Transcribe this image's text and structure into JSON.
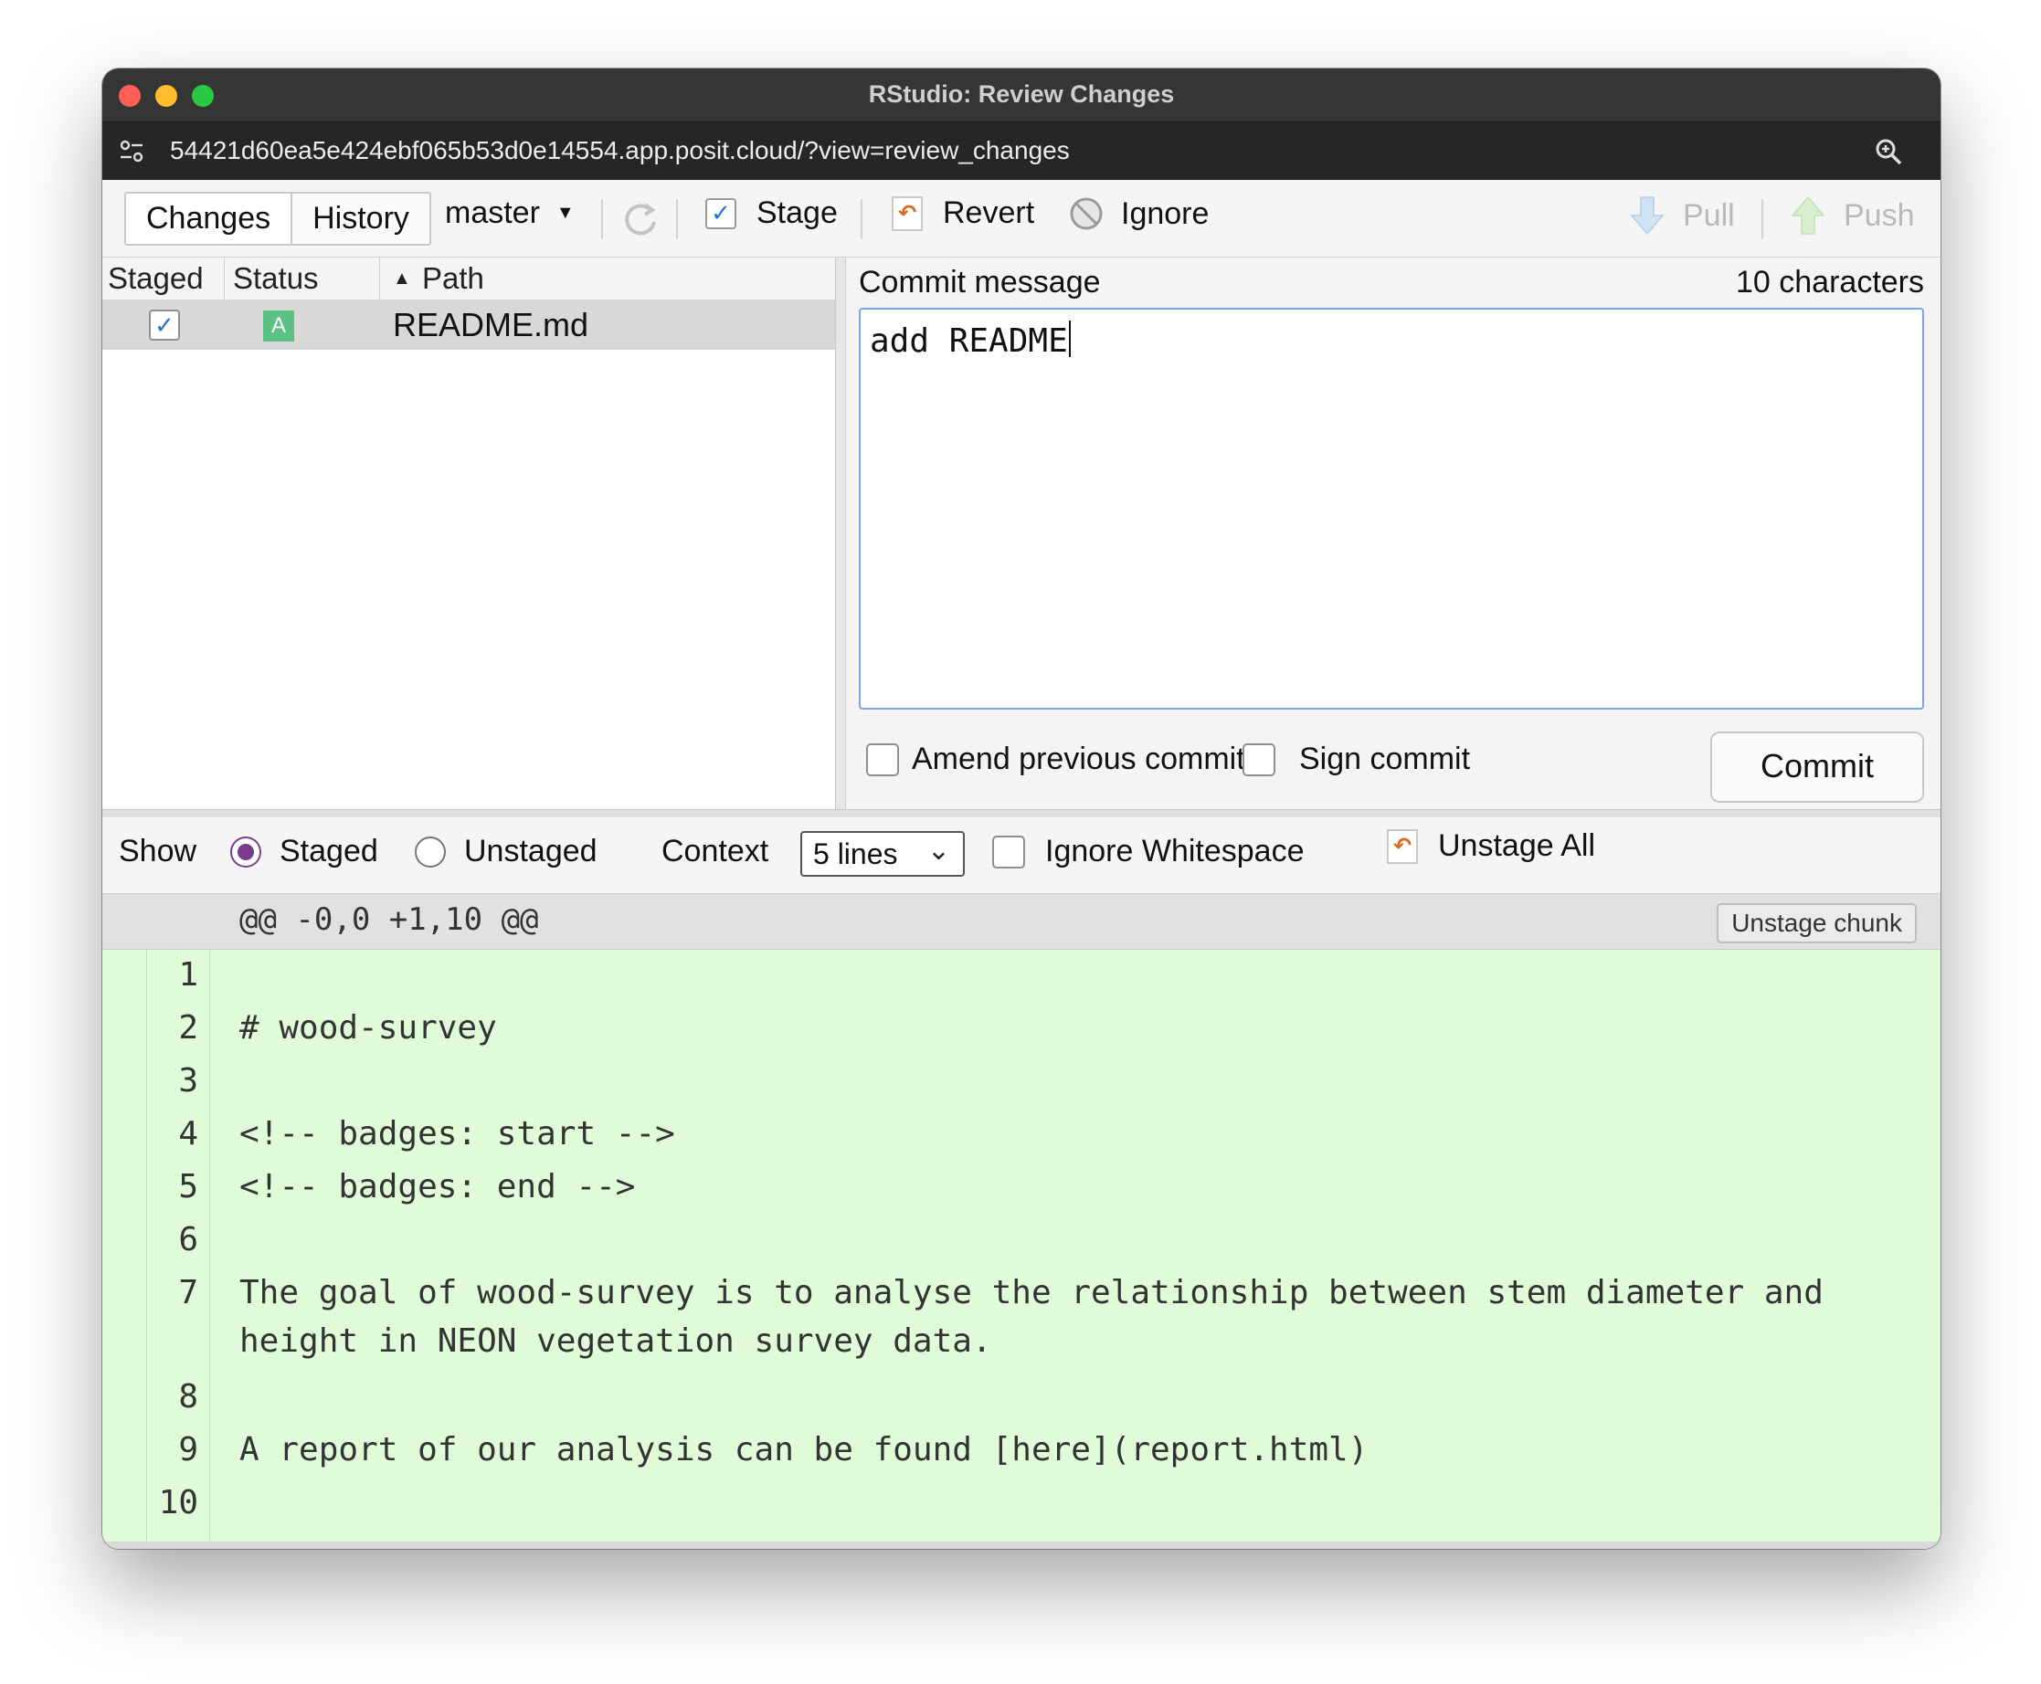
{
  "window": {
    "title": "RStudio: Review Changes",
    "url": "54421d60ea5e424ebf065b53d0e14554.app.posit.cloud/?view=review_changes"
  },
  "toolbar": {
    "tabs": [
      {
        "label": "Changes"
      },
      {
        "label": "History"
      }
    ],
    "branch": "master",
    "stage_label": "Stage",
    "revert_label": "Revert",
    "ignore_label": "Ignore",
    "pull_label": "Pull",
    "push_label": "Push"
  },
  "files": {
    "headers": {
      "staged": "Staged",
      "status": "Status",
      "path": "Path"
    },
    "rows": [
      {
        "status": "A",
        "path": "README.md",
        "staged": true
      }
    ]
  },
  "commit": {
    "label": "Commit message",
    "count": "10 characters",
    "message": "add README",
    "amend_label": "Amend previous commit",
    "sign_label": "Sign commit",
    "button_label": "Commit"
  },
  "show": {
    "label": "Show",
    "staged": "Staged",
    "unstaged": "Unstaged",
    "context_label": "Context",
    "context_value": "5 lines",
    "ignore_ws": "Ignore Whitespace",
    "unstage_all": "Unstage All"
  },
  "diff": {
    "hunk_header": "@@ -0,0 +1,10 @@",
    "unstage_chunk": "Unstage chunk",
    "lines": [
      {
        "num": "1",
        "text": ""
      },
      {
        "num": "2",
        "text": "# wood-survey"
      },
      {
        "num": "3",
        "text": ""
      },
      {
        "num": "4",
        "text": "<!-- badges: start -->"
      },
      {
        "num": "5",
        "text": "<!-- badges: end -->"
      },
      {
        "num": "6",
        "text": ""
      },
      {
        "num": "7",
        "text": "The goal of wood-survey is to analyse the relationship between stem diameter and",
        "text2": "height in NEON vegetation survey data."
      },
      {
        "num": "8",
        "text": ""
      },
      {
        "num": "9",
        "text": "A report of our analysis can be found [here](report.html)"
      },
      {
        "num": "10",
        "text": ""
      }
    ]
  },
  "colors": {
    "diff_added_bg": "#e0fbd8",
    "status_added": "#5bc184",
    "radio_selected": "#7b3b8e"
  }
}
